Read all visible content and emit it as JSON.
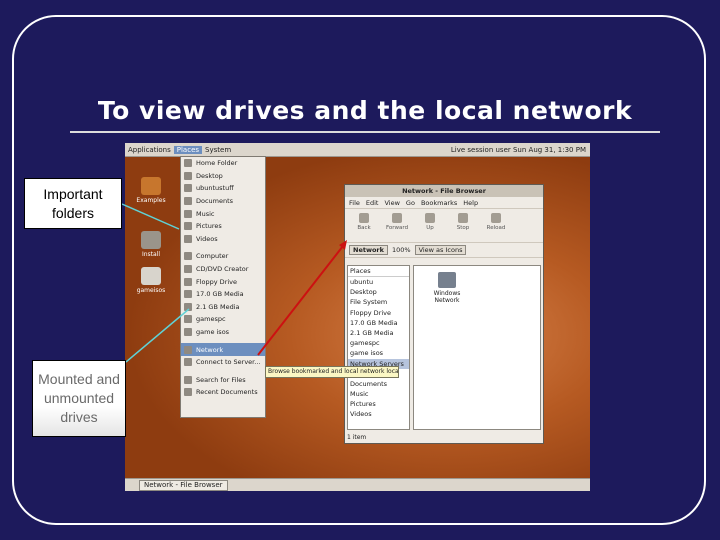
{
  "slide": {
    "title": "To view drives and the local network"
  },
  "callouts": {
    "important": "Important folders",
    "mounted": "Mounted and unmounted drives"
  },
  "screenshot": {
    "top_bar": {
      "applications": "Applications",
      "places": "Places",
      "system": "System",
      "status": "Live session user  Sun Aug 31, 1:30 PM"
    },
    "desktop_icons": [
      {
        "label": "Examples",
        "icon": "folder-icon"
      },
      {
        "label": "Install",
        "icon": "install-icon"
      },
      {
        "label": "gameisos",
        "icon": "drive-icon"
      }
    ],
    "places_menu": [
      "Home Folder",
      "Desktop",
      "ubuntustuff",
      "Documents",
      "Music",
      "Pictures",
      "Videos",
      "---",
      "Computer",
      "CD/DVD Creator",
      "Floppy Drive",
      "17.0 GB Media",
      "2.1 GB Media",
      "gamespc",
      "game isos",
      "---",
      "Network",
      "Connect to Server...",
      "---",
      "Search for Files",
      "Recent Documents"
    ],
    "places_menu_selected": "Network",
    "tooltip": "Browse bookmarked and local network locations",
    "file_browser": {
      "title": "Network - File Browser",
      "menus": [
        "File",
        "Edit",
        "View",
        "Go",
        "Bookmarks",
        "Help"
      ],
      "tools": [
        "Back",
        "Forward",
        "Up",
        "Stop",
        "Reload"
      ],
      "location": "Network",
      "zoom": "100%",
      "view_mode": "View as Icons",
      "sidebar_header": "Places",
      "sidebar": [
        "ubuntu",
        "Desktop",
        "File System",
        "Floppy Drive",
        "17.0 GB Media",
        "2.1 GB Media",
        "gamespc",
        "game isos",
        "Network Servers",
        "ubuntustuff",
        "Documents",
        "Music",
        "Pictures",
        "Videos"
      ],
      "sidebar_selected": "Network Servers",
      "content_item": "Windows Network",
      "status": "1 item"
    },
    "taskbar_item": "Network - File Browser"
  },
  "colors": {
    "background": "#1d1a5c",
    "title": "#ffffff",
    "arrow_red": "#cc1111",
    "callout_line": "#5fd2d6"
  }
}
